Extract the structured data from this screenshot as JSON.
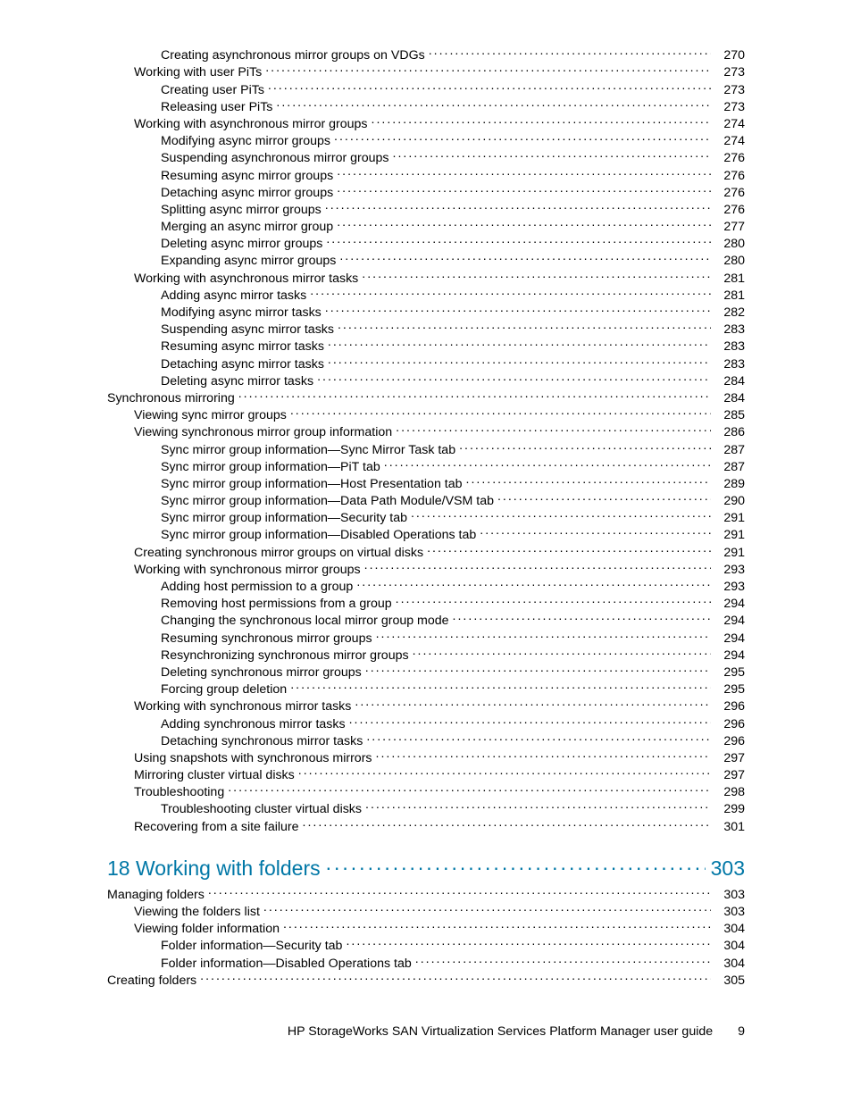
{
  "toc": [
    {
      "level": 3,
      "label": "Creating asynchronous mirror groups on VDGs",
      "page": "270"
    },
    {
      "level": 2,
      "label": "Working with user PiTs",
      "page": "273"
    },
    {
      "level": 3,
      "label": "Creating user PiTs",
      "page": "273"
    },
    {
      "level": 3,
      "label": "Releasing user PiTs",
      "page": "273"
    },
    {
      "level": 2,
      "label": "Working with asynchronous mirror groups",
      "page": "274"
    },
    {
      "level": 3,
      "label": "Modifying async mirror groups",
      "page": "274"
    },
    {
      "level": 3,
      "label": "Suspending asynchronous mirror groups",
      "page": "276"
    },
    {
      "level": 3,
      "label": "Resuming async mirror groups",
      "page": "276"
    },
    {
      "level": 3,
      "label": "Detaching async mirror groups",
      "page": "276"
    },
    {
      "level": 3,
      "label": "Splitting async mirror groups",
      "page": "276"
    },
    {
      "level": 3,
      "label": "Merging an async mirror group",
      "page": "277"
    },
    {
      "level": 3,
      "label": "Deleting async mirror groups",
      "page": "280"
    },
    {
      "level": 3,
      "label": "Expanding async mirror groups",
      "page": "280"
    },
    {
      "level": 2,
      "label": "Working with asynchronous mirror tasks",
      "page": "281"
    },
    {
      "level": 3,
      "label": "Adding async mirror tasks",
      "page": "281"
    },
    {
      "level": 3,
      "label": "Modifying async mirror tasks",
      "page": "282"
    },
    {
      "level": 3,
      "label": "Suspending async mirror tasks",
      "page": "283"
    },
    {
      "level": 3,
      "label": "Resuming async mirror tasks",
      "page": "283"
    },
    {
      "level": 3,
      "label": "Detaching async mirror tasks",
      "page": "283"
    },
    {
      "level": 3,
      "label": "Deleting async mirror tasks",
      "page": "284"
    },
    {
      "level": 1,
      "label": "Synchronous mirroring",
      "page": "284"
    },
    {
      "level": 2,
      "label": "Viewing sync mirror groups",
      "page": "285"
    },
    {
      "level": 2,
      "label": "Viewing synchronous mirror group information",
      "page": "286"
    },
    {
      "level": 3,
      "label": "Sync mirror group information—Sync Mirror Task tab",
      "page": "287"
    },
    {
      "level": 3,
      "label": "Sync mirror group information—PiT tab",
      "page": "287"
    },
    {
      "level": 3,
      "label": "Sync mirror group information—Host Presentation tab",
      "page": "289"
    },
    {
      "level": 3,
      "label": "Sync mirror group information—Data Path Module/VSM tab",
      "page": "290"
    },
    {
      "level": 3,
      "label": "Sync mirror group information—Security tab",
      "page": "291"
    },
    {
      "level": 3,
      "label": "Sync mirror group information—Disabled Operations tab",
      "page": "291"
    },
    {
      "level": 2,
      "label": "Creating synchronous mirror groups on virtual disks",
      "page": "291"
    },
    {
      "level": 2,
      "label": "Working with synchronous mirror groups",
      "page": "293"
    },
    {
      "level": 3,
      "label": "Adding host permission to a group",
      "page": "293"
    },
    {
      "level": 3,
      "label": "Removing host permissions from a group",
      "page": "294"
    },
    {
      "level": 3,
      "label": "Changing the synchronous local mirror group mode",
      "page": "294"
    },
    {
      "level": 3,
      "label": "Resuming synchronous mirror groups",
      "page": "294"
    },
    {
      "level": 3,
      "label": "Resynchronizing synchronous mirror groups",
      "page": "294"
    },
    {
      "level": 3,
      "label": "Deleting synchronous mirror groups",
      "page": "295"
    },
    {
      "level": 3,
      "label": "Forcing group deletion",
      "page": "295"
    },
    {
      "level": 2,
      "label": "Working with synchronous mirror tasks",
      "page": "296"
    },
    {
      "level": 3,
      "label": "Adding synchronous mirror tasks",
      "page": "296"
    },
    {
      "level": 3,
      "label": "Detaching synchronous mirror tasks",
      "page": "296"
    },
    {
      "level": 2,
      "label": "Using snapshots with synchronous mirrors",
      "page": "297"
    },
    {
      "level": 2,
      "label": "Mirroring cluster virtual disks",
      "page": "297"
    },
    {
      "level": 2,
      "label": "Troubleshooting",
      "page": "298"
    },
    {
      "level": 3,
      "label": "Troubleshooting cluster virtual disks",
      "page": "299"
    },
    {
      "level": 2,
      "label": "Recovering from a site failure",
      "page": "301"
    }
  ],
  "chapter": {
    "label": "18 Working with folders",
    "page": "303"
  },
  "toc2": [
    {
      "level": 1,
      "label": "Managing folders",
      "page": "303"
    },
    {
      "level": 2,
      "label": "Viewing the folders list",
      "page": "303"
    },
    {
      "level": 2,
      "label": "Viewing folder information",
      "page": "304"
    },
    {
      "level": 3,
      "label": "Folder information—Security tab",
      "page": "304"
    },
    {
      "level": 3,
      "label": "Folder information—Disabled Operations tab",
      "page": "304"
    },
    {
      "level": 1,
      "label": "Creating folders",
      "page": "305"
    }
  ],
  "footer": {
    "title": "HP StorageWorks SAN Virtualization Services Platform Manager user guide",
    "page": "9"
  }
}
